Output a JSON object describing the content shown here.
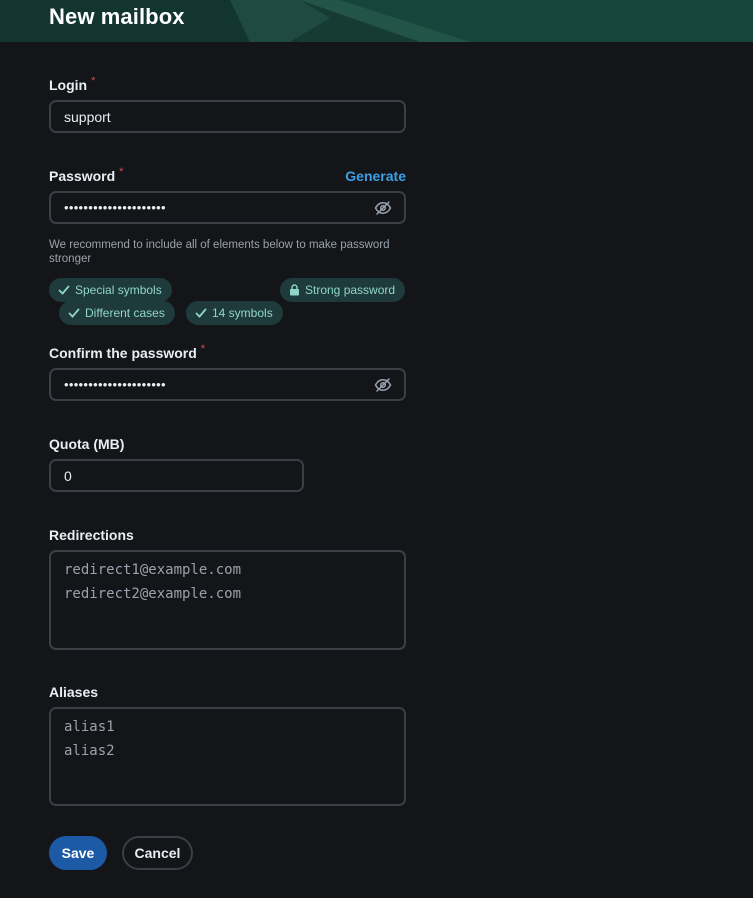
{
  "header": {
    "title": "New mailbox"
  },
  "login": {
    "label": "Login",
    "required_mark": "*",
    "value": "support"
  },
  "password": {
    "label": "Password",
    "required_mark": "*",
    "generate_label": "Generate",
    "value_masked": "•••••••••••••••••••••",
    "hint": "We recommend to include all of elements below to make password stronger",
    "chips": {
      "special": "Special symbols",
      "strong": "Strong password",
      "cases": "Different cases",
      "length": "14 symbols"
    }
  },
  "confirm": {
    "label": "Confirm the password",
    "required_mark": "*",
    "value_masked": "•••••••••••••••••••••"
  },
  "quota": {
    "label": "Quota (MB)",
    "value": "0"
  },
  "redirections": {
    "label": "Redirections",
    "placeholder_lines": [
      "redirect1@example.com",
      "redirect2@example.com"
    ]
  },
  "aliases": {
    "label": "Aliases",
    "placeholder_lines": [
      "alias1",
      "alias2"
    ]
  },
  "actions": {
    "save_label": "Save",
    "cancel_label": "Cancel"
  },
  "colors": {
    "accent": "#3aa0e6",
    "primary_button": "#1d5aa6",
    "required": "#e14b4b",
    "chip_bg": "#1f3a3a",
    "chip_text": "#8fd6c8",
    "header_bg": "#153b33"
  },
  "icons": {
    "visibility_toggle": "eye-off-icon",
    "check": "check-icon",
    "lock": "lock-icon"
  }
}
